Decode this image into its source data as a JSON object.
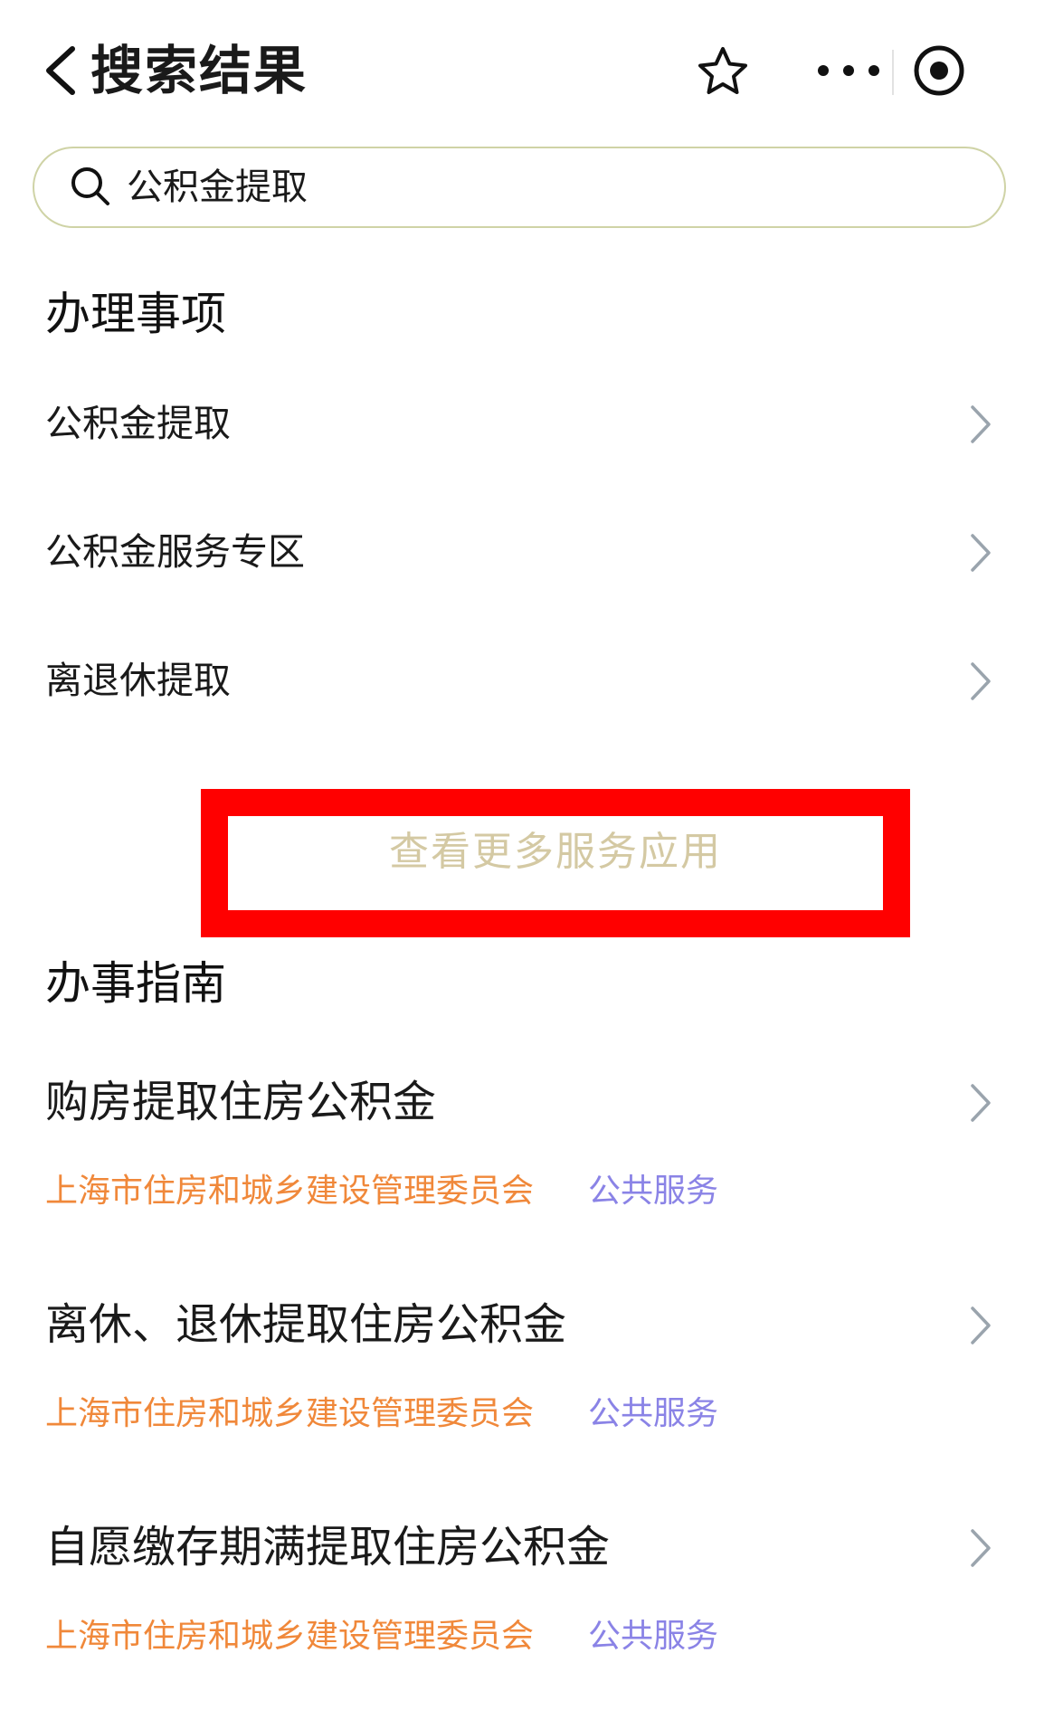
{
  "header": {
    "title": "搜索结果",
    "icons": {
      "back": "chevron-left-icon",
      "favorite": "star-icon",
      "more": "more-dots-icon",
      "record": "record-icon"
    }
  },
  "search": {
    "value": "公积金提取",
    "icon": "search-icon"
  },
  "services": {
    "title": "办理事项",
    "items": [
      {
        "label": "公积金提取"
      },
      {
        "label": "公积金服务专区"
      },
      {
        "label": "离退休提取"
      }
    ],
    "more_label": "查看更多服务应用"
  },
  "guides": {
    "title": "办事指南",
    "items": [
      {
        "title": "购房提取住房公积金",
        "dept": "上海市住房和城乡建设管理委员会",
        "tag": "公共服务"
      },
      {
        "title": "离休、退休提取住房公积金",
        "dept": "上海市住房和城乡建设管理委员会",
        "tag": "公共服务"
      },
      {
        "title": "自愿缴存期满提取住房公积金",
        "dept": "上海市住房和城乡建设管理委员会",
        "tag": "公共服务"
      }
    ]
  },
  "colors": {
    "highlight_border": "#ff0000",
    "more_text": "#d4c9a3",
    "dept_text": "#f0883a",
    "tag_text": "#8a83e6",
    "search_border": "#cfd3a6",
    "chevron": "#9aa4ad"
  }
}
